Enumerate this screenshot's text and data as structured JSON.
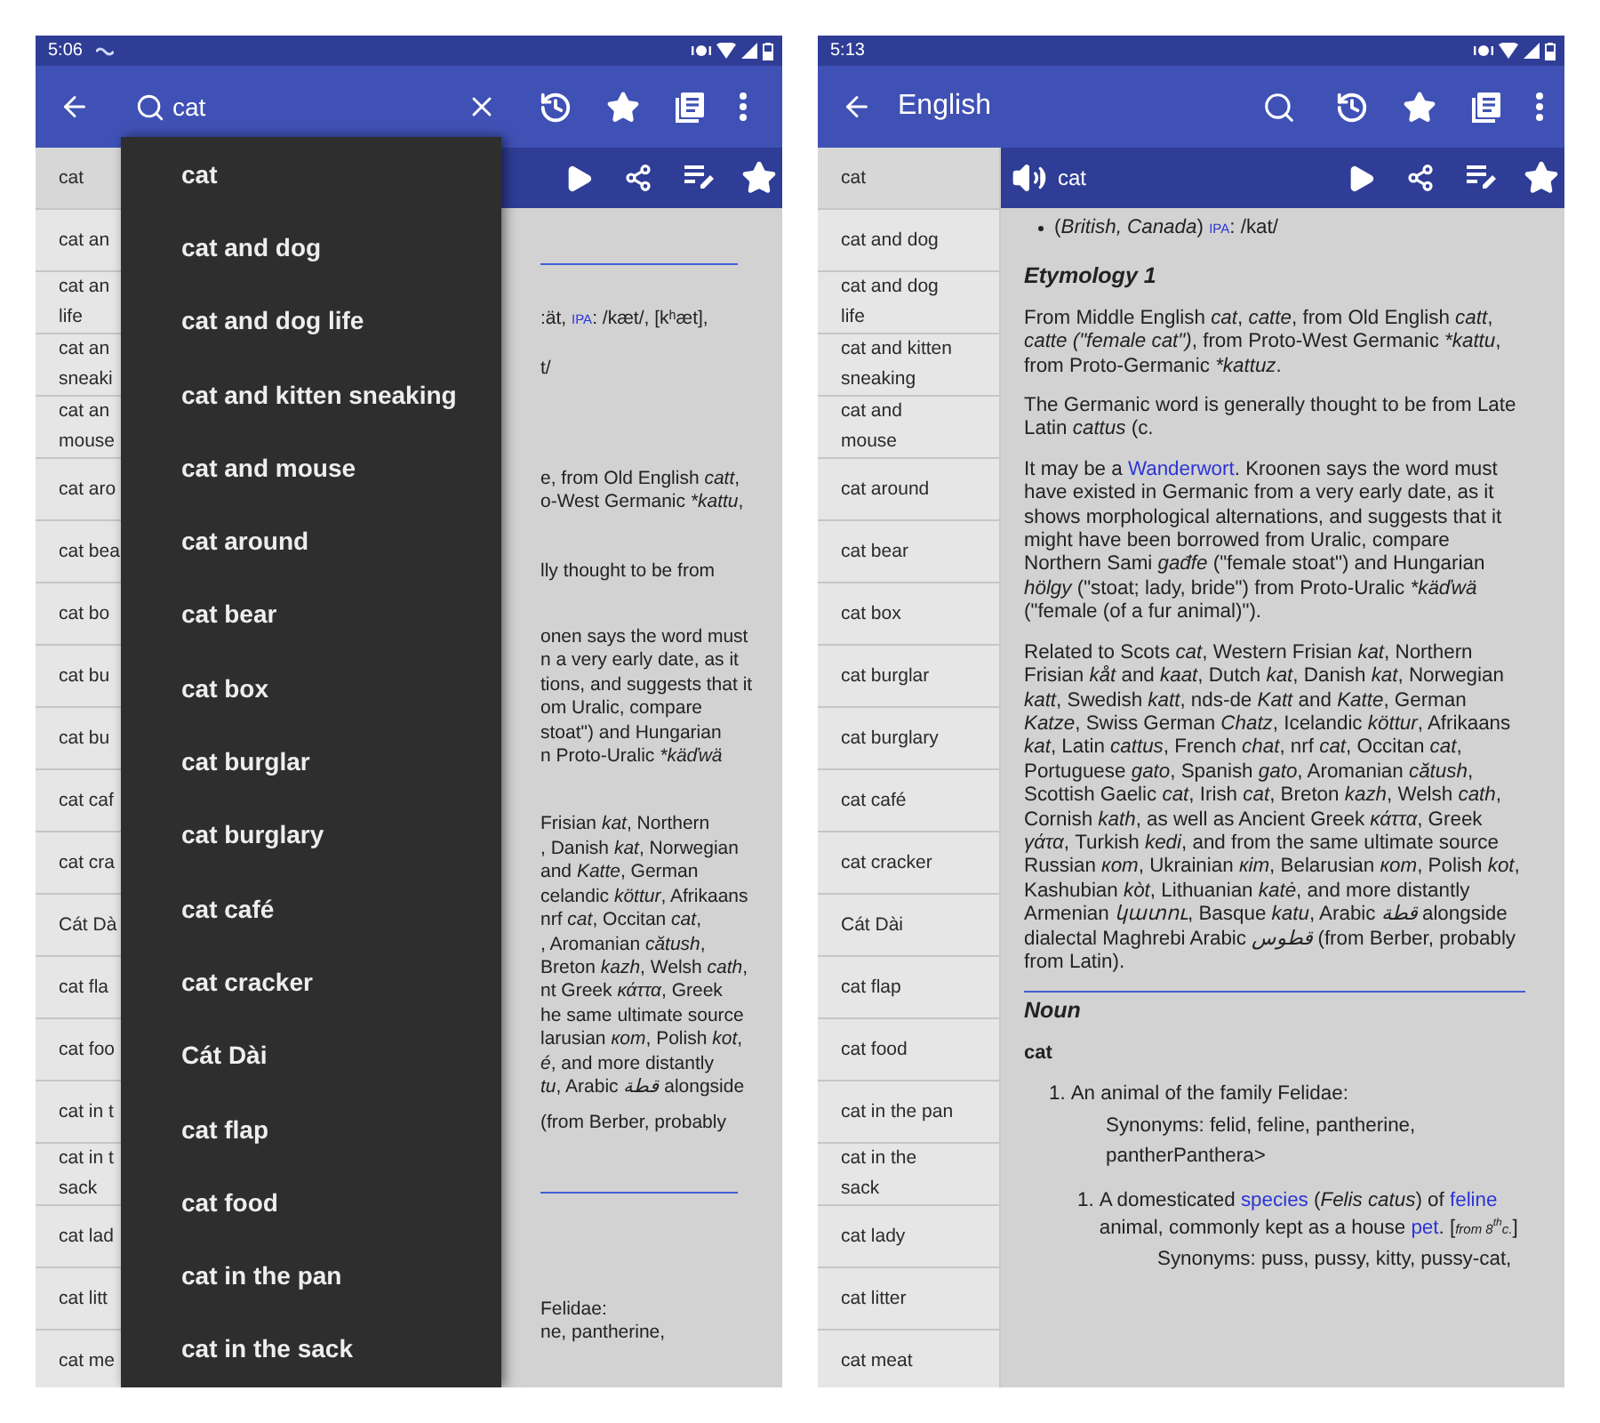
{
  "phones": [
    {
      "status_bar": {
        "time": "5:06",
        "notification_icon": true
      },
      "app_bar": {
        "kind": "search",
        "query": "cat"
      },
      "sidebar": [
        {
          "text": "cat",
          "selected": true
        },
        {
          "text": "cat an",
          "selected": false
        },
        {
          "text": "cat an\nlife",
          "selected": false
        },
        {
          "text": "cat an\nsneaki",
          "selected": false
        },
        {
          "text": "cat an\nmouse",
          "selected": false
        },
        {
          "text": "cat aro",
          "selected": false
        },
        {
          "text": "cat bea",
          "selected": false
        },
        {
          "text": "cat bo",
          "selected": false
        },
        {
          "text": "cat bu",
          "selected": false
        },
        {
          "text": "cat bu",
          "selected": false
        },
        {
          "text": "cat caf",
          "selected": false
        },
        {
          "text": "cat cra",
          "selected": false
        },
        {
          "text": "Cát Dà",
          "selected": false
        },
        {
          "text": "cat fla",
          "selected": false
        },
        {
          "text": "cat foo",
          "selected": false
        },
        {
          "text": "cat in t",
          "selected": false
        },
        {
          "text": "cat in t\nsack",
          "selected": false
        },
        {
          "text": "cat lad",
          "selected": false
        },
        {
          "text": "cat litt",
          "selected": false
        },
        {
          "text": "cat me",
          "selected": false
        }
      ],
      "suggestions": [
        "cat",
        "cat and dog",
        "cat and dog life",
        "cat and kitten sneaking",
        "cat and mouse",
        "cat around",
        "cat bear",
        "cat box",
        "cat burglar",
        "cat burglary",
        "cat café",
        "cat cracker",
        "Cát Dài",
        "cat flap",
        "cat food",
        "cat in the pan",
        "cat in the sack"
      ],
      "content_fragments": [
        {
          "kind": "rule"
        },
        {
          "kind": "para",
          "lines": [
            [
              {
                "text": ":ät, "
              },
              {
                "text": "IPA",
                "kind": "tag"
              },
              {
                "text": ": /kæt/, [kʰæt],"
              }
            ]
          ]
        },
        {
          "kind": "para",
          "lines": [
            [
              {
                "text": "t/"
              }
            ]
          ]
        },
        {
          "kind": "para",
          "lines": [
            [
              {
                "text": "e, from Old English "
              },
              {
                "text": "catt",
                "kind": "italic"
              },
              {
                "text": ","
              }
            ],
            [
              {
                "text": "o-West Germanic "
              },
              {
                "text": "*kattu",
                "kind": "italic"
              },
              {
                "text": ","
              }
            ]
          ]
        },
        {
          "kind": "para",
          "lines": [
            [
              {
                "text": "lly thought to be from"
              }
            ]
          ]
        },
        {
          "kind": "para",
          "lines": [
            [
              {
                "text": "onen says the word must"
              }
            ],
            [
              {
                "text": "n a very early date, as it"
              }
            ],
            [
              {
                "text": "tions, and suggests that it"
              }
            ],
            [
              {
                "text": "om Uralic, compare"
              }
            ],
            [
              {
                "text": "stoat\") and Hungarian"
              }
            ],
            [
              {
                "text": "n Proto-Uralic "
              },
              {
                "text": "*käďwä",
                "kind": "italic"
              }
            ]
          ]
        },
        {
          "kind": "para",
          "lines": [
            [
              {
                "text": "Frisian "
              },
              {
                "text": "kat",
                "kind": "italic"
              },
              {
                "text": ", Northern"
              }
            ],
            [
              {
                "text": ", Danish "
              },
              {
                "text": "kat",
                "kind": "italic"
              },
              {
                "text": ", Norwegian"
              }
            ],
            [
              {
                "text": "and "
              },
              {
                "text": "Katte",
                "kind": "italic"
              },
              {
                "text": ", German"
              }
            ],
            [
              {
                "text": "celandic "
              },
              {
                "text": "köttur",
                "kind": "italic"
              },
              {
                "text": ", Afrikaans"
              }
            ],
            [
              {
                "text": "nrf "
              },
              {
                "text": "cat",
                "kind": "italic"
              },
              {
                "text": ", Occitan "
              },
              {
                "text": "cat",
                "kind": "italic"
              },
              {
                "text": ","
              }
            ],
            [
              {
                "text": ", Aromanian "
              },
              {
                "text": "cătush",
                "kind": "italic"
              },
              {
                "text": ","
              }
            ],
            [
              {
                "text": "Breton "
              },
              {
                "text": "kazh",
                "kind": "italic"
              },
              {
                "text": ", Welsh "
              },
              {
                "text": "cath",
                "kind": "italic"
              },
              {
                "text": ","
              }
            ],
            [
              {
                "text": "nt Greek "
              },
              {
                "text": "κάττα",
                "kind": "italic"
              },
              {
                "text": ", Greek"
              }
            ],
            [
              {
                "text": "he same ultimate source"
              }
            ],
            [
              {
                "text": "larusian "
              },
              {
                "text": "кот",
                "kind": "italic"
              },
              {
                "text": ", Polish "
              },
              {
                "text": "kot",
                "kind": "italic"
              },
              {
                "text": ","
              }
            ],
            [
              {
                "text": "é",
                "kind": "italic"
              },
              {
                "text": ", and more distantly"
              }
            ],
            [
              {
                "text": "tu",
                "kind": "italic"
              },
              {
                "text": ", Arabic "
              },
              {
                "text": "قطة",
                "kind": "italic"
              },
              {
                "text": " alongside"
              }
            ]
          ]
        },
        {
          "kind": "para",
          "lines": [
            [
              {
                "text": "(from Berber, probably"
              }
            ]
          ]
        },
        {
          "kind": "rule"
        },
        {
          "kind": "para",
          "lines": [
            [
              {
                "text": "Felidae:"
              }
            ],
            [
              {
                "text": "ne, pantherine,"
              }
            ]
          ]
        }
      ]
    },
    {
      "status_bar": {
        "time": "5:13"
      },
      "app_bar": {
        "kind": "title",
        "title": "English"
      },
      "word_bar": {
        "title": "cat"
      },
      "sidebar": [
        {
          "text": "cat",
          "selected": true
        },
        {
          "text": "cat and dog",
          "selected": false
        },
        {
          "text": "cat and dog\nlife",
          "selected": false
        },
        {
          "text": "cat and kitten\nsneaking",
          "selected": false
        },
        {
          "text": "cat and\nmouse",
          "selected": false
        },
        {
          "text": "cat around",
          "selected": false
        },
        {
          "text": "cat bear",
          "selected": false
        },
        {
          "text": "cat box",
          "selected": false
        },
        {
          "text": "cat burglar",
          "selected": false
        },
        {
          "text": "cat burglary",
          "selected": false
        },
        {
          "text": "cat café",
          "selected": false
        },
        {
          "text": "cat cracker",
          "selected": false
        },
        {
          "text": "Cát Dài",
          "selected": false
        },
        {
          "text": "cat flap",
          "selected": false
        },
        {
          "text": "cat food",
          "selected": false
        },
        {
          "text": "cat in the pan",
          "selected": false
        },
        {
          "text": "cat in the\nsack",
          "selected": false
        },
        {
          "text": "cat lady",
          "selected": false
        },
        {
          "text": "cat litter",
          "selected": false
        },
        {
          "text": "cat meat",
          "selected": false
        }
      ],
      "content": [
        {
          "kind": "bullet",
          "segs": [
            {
              "text": "("
            },
            {
              "text": "British, Canada",
              "kind": "italic"
            },
            {
              "text": ") "
            },
            {
              "text": "IPA",
              "kind": "tag"
            },
            {
              "text": ": /kat/"
            }
          ]
        },
        {
          "kind": "heading",
          "text": "Etymology 1"
        },
        {
          "kind": "para",
          "segs": [
            {
              "text": "From Middle English "
            },
            {
              "text": "cat",
              "kind": "italic"
            },
            {
              "text": ", "
            },
            {
              "text": "catte",
              "kind": "italic"
            },
            {
              "text": ", from Old English "
            },
            {
              "text": "catt",
              "kind": "italic"
            },
            {
              "text": ", "
            },
            {
              "text": "catte (\"female cat\")",
              "kind": "italic"
            },
            {
              "text": ", from Proto-West Germanic "
            },
            {
              "text": "*kattu",
              "kind": "italic"
            },
            {
              "text": ", from Proto-Germanic "
            },
            {
              "text": "*kattuz",
              "kind": "italic"
            },
            {
              "text": "."
            }
          ]
        },
        {
          "kind": "para",
          "segs": [
            {
              "text": "The Germanic word is generally thought to be from Late Latin "
            },
            {
              "text": "cattus",
              "kind": "italic"
            },
            {
              "text": " (c."
            }
          ]
        },
        {
          "kind": "para",
          "segs": [
            {
              "text": "It may be a "
            },
            {
              "text": "Wanderwort",
              "kind": "link"
            },
            {
              "text": ". Kroonen says the word must have existed in Germanic from a very early date, as it shows morphological alternations, and suggests that it might have been borrowed from Uralic, compare Northern Sami "
            },
            {
              "text": "gađfe",
              "kind": "italic"
            },
            {
              "text": " (\"female stoat\") and Hungarian "
            },
            {
              "text": "hölgy",
              "kind": "italic"
            },
            {
              "text": " (\"stoat; lady, bride\") from Proto-Uralic "
            },
            {
              "text": "*käďwä",
              "kind": "italic"
            },
            {
              "text": " (\"female (of a fur animal)\")."
            }
          ]
        },
        {
          "kind": "para",
          "segs": [
            {
              "text": "Related to Scots "
            },
            {
              "text": "cat",
              "kind": "italic"
            },
            {
              "text": ", Western Frisian "
            },
            {
              "text": "kat",
              "kind": "italic"
            },
            {
              "text": ", Northern Frisian "
            },
            {
              "text": "kåt",
              "kind": "italic"
            },
            {
              "text": " and "
            },
            {
              "text": "kaat",
              "kind": "italic"
            },
            {
              "text": ", Dutch "
            },
            {
              "text": "kat",
              "kind": "italic"
            },
            {
              "text": ", Danish "
            },
            {
              "text": "kat",
              "kind": "italic"
            },
            {
              "text": ", Norwegian "
            },
            {
              "text": "katt",
              "kind": "italic"
            },
            {
              "text": ", Swedish "
            },
            {
              "text": "katt",
              "kind": "italic"
            },
            {
              "text": ", nds-de "
            },
            {
              "text": "Katt",
              "kind": "italic"
            },
            {
              "text": " and "
            },
            {
              "text": "Katte",
              "kind": "italic"
            },
            {
              "text": ", German "
            },
            {
              "text": "Katze",
              "kind": "italic"
            },
            {
              "text": ", Swiss German "
            },
            {
              "text": "Chatz",
              "kind": "italic"
            },
            {
              "text": ", Icelandic "
            },
            {
              "text": "köttur",
              "kind": "italic"
            },
            {
              "text": ", Afrikaans "
            },
            {
              "text": "kat",
              "kind": "italic"
            },
            {
              "text": ", Latin "
            },
            {
              "text": "cattus",
              "kind": "italic"
            },
            {
              "text": ", French "
            },
            {
              "text": "chat",
              "kind": "italic"
            },
            {
              "text": ", nrf "
            },
            {
              "text": "cat",
              "kind": "italic"
            },
            {
              "text": ", Occitan "
            },
            {
              "text": "cat",
              "kind": "italic"
            },
            {
              "text": ", Portuguese "
            },
            {
              "text": "gato",
              "kind": "italic"
            },
            {
              "text": ", Spanish "
            },
            {
              "text": "gato",
              "kind": "italic"
            },
            {
              "text": ", Aromanian "
            },
            {
              "text": "cătush",
              "kind": "italic"
            },
            {
              "text": ", Scottish Gaelic "
            },
            {
              "text": "cat",
              "kind": "italic"
            },
            {
              "text": ", Irish "
            },
            {
              "text": "cat",
              "kind": "italic"
            },
            {
              "text": ", Breton "
            },
            {
              "text": "kazh",
              "kind": "italic"
            },
            {
              "text": ", Welsh "
            },
            {
              "text": "cath",
              "kind": "italic"
            },
            {
              "text": ", Cornish "
            },
            {
              "text": "kath",
              "kind": "italic"
            },
            {
              "text": ", as well as Ancient Greek "
            },
            {
              "text": "κάττα",
              "kind": "italic"
            },
            {
              "text": ", Greek "
            },
            {
              "text": "γάτα",
              "kind": "italic"
            },
            {
              "text": ", Turkish "
            },
            {
              "text": "kedi",
              "kind": "italic"
            },
            {
              "text": ", and from the same ultimate source Russian "
            },
            {
              "text": "кот",
              "kind": "italic"
            },
            {
              "text": ", Ukrainian "
            },
            {
              "text": "кіт",
              "kind": "italic"
            },
            {
              "text": ", Belarusian "
            },
            {
              "text": "кот",
              "kind": "italic"
            },
            {
              "text": ", Polish "
            },
            {
              "text": "kot",
              "kind": "italic"
            },
            {
              "text": ", Kashubian "
            },
            {
              "text": "kòt",
              "kind": "italic"
            },
            {
              "text": ", Lithuanian "
            },
            {
              "text": "katė",
              "kind": "italic"
            },
            {
              "text": ", and more distantly Armenian "
            },
            {
              "text": "կատու",
              "kind": "italic"
            },
            {
              "text": ", Basque "
            },
            {
              "text": "katu",
              "kind": "italic"
            },
            {
              "text": ", Arabic "
            },
            {
              "text": "قطة",
              "kind": "italic"
            },
            {
              "text": " alongside dialectal Maghrebi Arabic "
            },
            {
              "text": "قطوس",
              "kind": "italic"
            },
            {
              "text": " (from Berber, probably from Latin)."
            }
          ]
        },
        {
          "kind": "rule"
        },
        {
          "kind": "heading",
          "text": "Noun"
        },
        {
          "kind": "headword",
          "text": "cat"
        },
        {
          "kind": "sense",
          "number": "1.",
          "segs": [
            {
              "text": "An animal of the family Felidae:"
            }
          ],
          "synonyms": "Synonyms: felid, feline, pantherine, pantherPanthera>",
          "children": [
            {
              "number": "1.",
              "segs": [
                {
                  "text": "A domesticated "
                },
                {
                  "text": "species",
                  "kind": "link"
                },
                {
                  "text": " ("
                },
                {
                  "text": "Felis catus",
                  "kind": "italic"
                },
                {
                  "text": ") of "
                },
                {
                  "text": "feline",
                  "kind": "link"
                },
                {
                  "text": " animal, commonly kept as a house "
                },
                {
                  "text": "pet",
                  "kind": "link"
                },
                {
                  "text": ". ["
                },
                {
                  "text": "from 8",
                  "kind": "note"
                },
                {
                  "text": "th",
                  "kind": "sup"
                },
                {
                  "text": "c.",
                  "kind": "note"
                },
                {
                  "text": "]"
                }
              ],
              "synonyms": "Synonyms: puss, pussy, kitty, pussy-cat,"
            }
          ]
        }
      ]
    }
  ]
}
